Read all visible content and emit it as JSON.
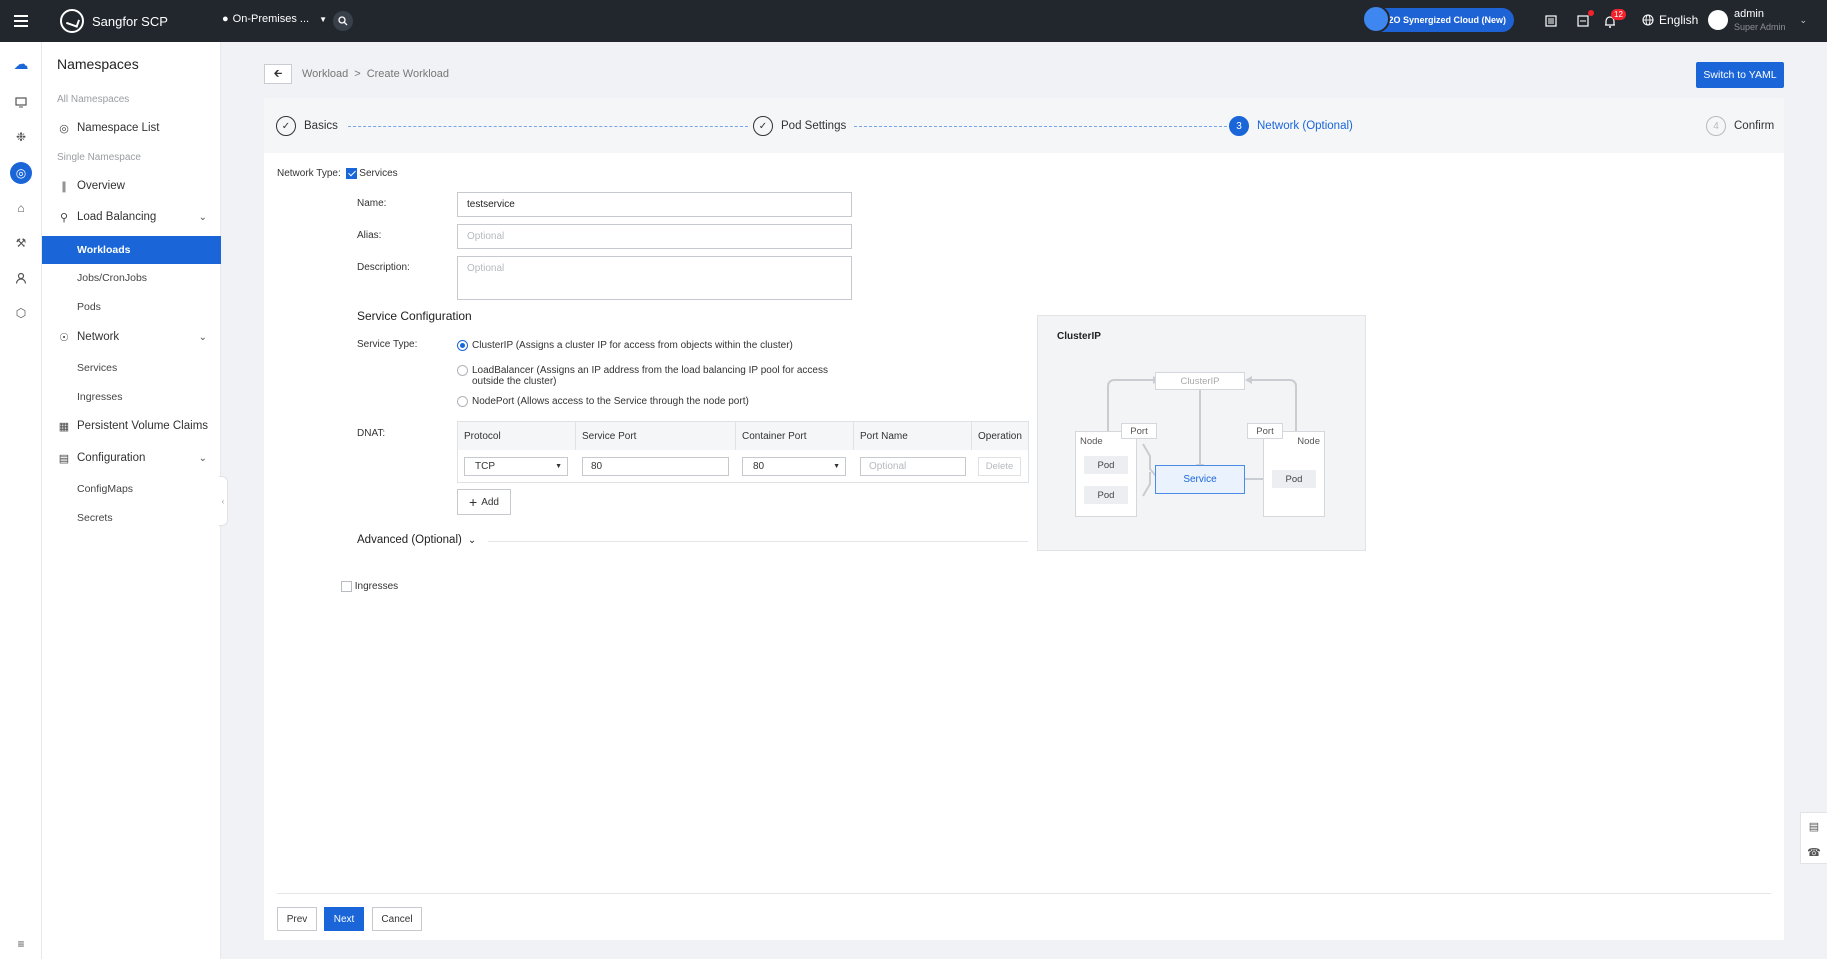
{
  "topbar": {
    "brand": "Sangfor SCP",
    "location": "On-Premises ...",
    "o2o_label": "O2O Synergized Cloud (New)",
    "notifications_count": "12",
    "language": "English",
    "user_name": "admin",
    "user_role": "Super Admin"
  },
  "sidebar": {
    "title": "Namespaces",
    "group_all": "All Namespaces",
    "namespace_list": "Namespace List",
    "group_single": "Single Namespace",
    "overview": "Overview",
    "load_balancing": "Load Balancing",
    "workloads": "Workloads",
    "jobs": "Jobs/CronJobs",
    "pods": "Pods",
    "network": "Network",
    "services": "Services",
    "ingresses": "Ingresses",
    "pvc": "Persistent Volume Claims",
    "configuration": "Configuration",
    "configmaps": "ConfigMaps",
    "secrets": "Secrets"
  },
  "breadcrumb": {
    "parent": "Workload",
    "separator": ">",
    "current": "Create Workload"
  },
  "switch_yaml": "Switch to YAML",
  "steps": [
    {
      "label": "Basics",
      "marker": "✓",
      "state": "done"
    },
    {
      "label": "Pod Settings",
      "marker": "✓",
      "state": "done"
    },
    {
      "label": "Network (Optional)",
      "marker": "3",
      "state": "active"
    },
    {
      "label": "Confirm",
      "marker": "4",
      "state": "pending"
    }
  ],
  "form": {
    "network_type_label": "Network Type:",
    "services_label": "Services",
    "services_checked": true,
    "name_label": "Name:",
    "name_value": "testservice",
    "alias_label": "Alias:",
    "alias_placeholder": "Optional",
    "description_label": "Description:",
    "description_placeholder": "Optional",
    "service_config_title": "Service Configuration",
    "service_type_label": "Service Type:",
    "service_types": [
      {
        "label": "ClusterIP (Assigns a cluster IP for access from objects within the cluster)",
        "selected": true
      },
      {
        "label": "LoadBalancer (Assigns an IP address from the load balancing IP pool for access outside the cluster)",
        "selected": false
      },
      {
        "label": "NodePort (Allows access to the Service through the node port)",
        "selected": false
      }
    ],
    "dnat_label": "DNAT:",
    "dnat_columns": [
      "Protocol",
      "Service Port",
      "Container Port",
      "Port Name",
      "Operation"
    ],
    "dnat_row": {
      "protocol": "TCP",
      "service_port": "80",
      "container_port": "80",
      "port_name_placeholder": "Optional",
      "delete": "Delete"
    },
    "add_label": "Add",
    "advanced_label": "Advanced (Optional)",
    "ingresses_label": "Ingresses",
    "ingresses_checked": false
  },
  "diagram": {
    "title": "ClusterIP",
    "clusterip": "ClusterIP",
    "node": "Node",
    "port": "Port",
    "pod": "Pod",
    "service": "Service"
  },
  "footer": {
    "prev": "Prev",
    "next": "Next",
    "cancel": "Cancel"
  },
  "colors": {
    "accent": "#1a66d9",
    "topbar": "#22272e",
    "badge": "#f5222d"
  }
}
